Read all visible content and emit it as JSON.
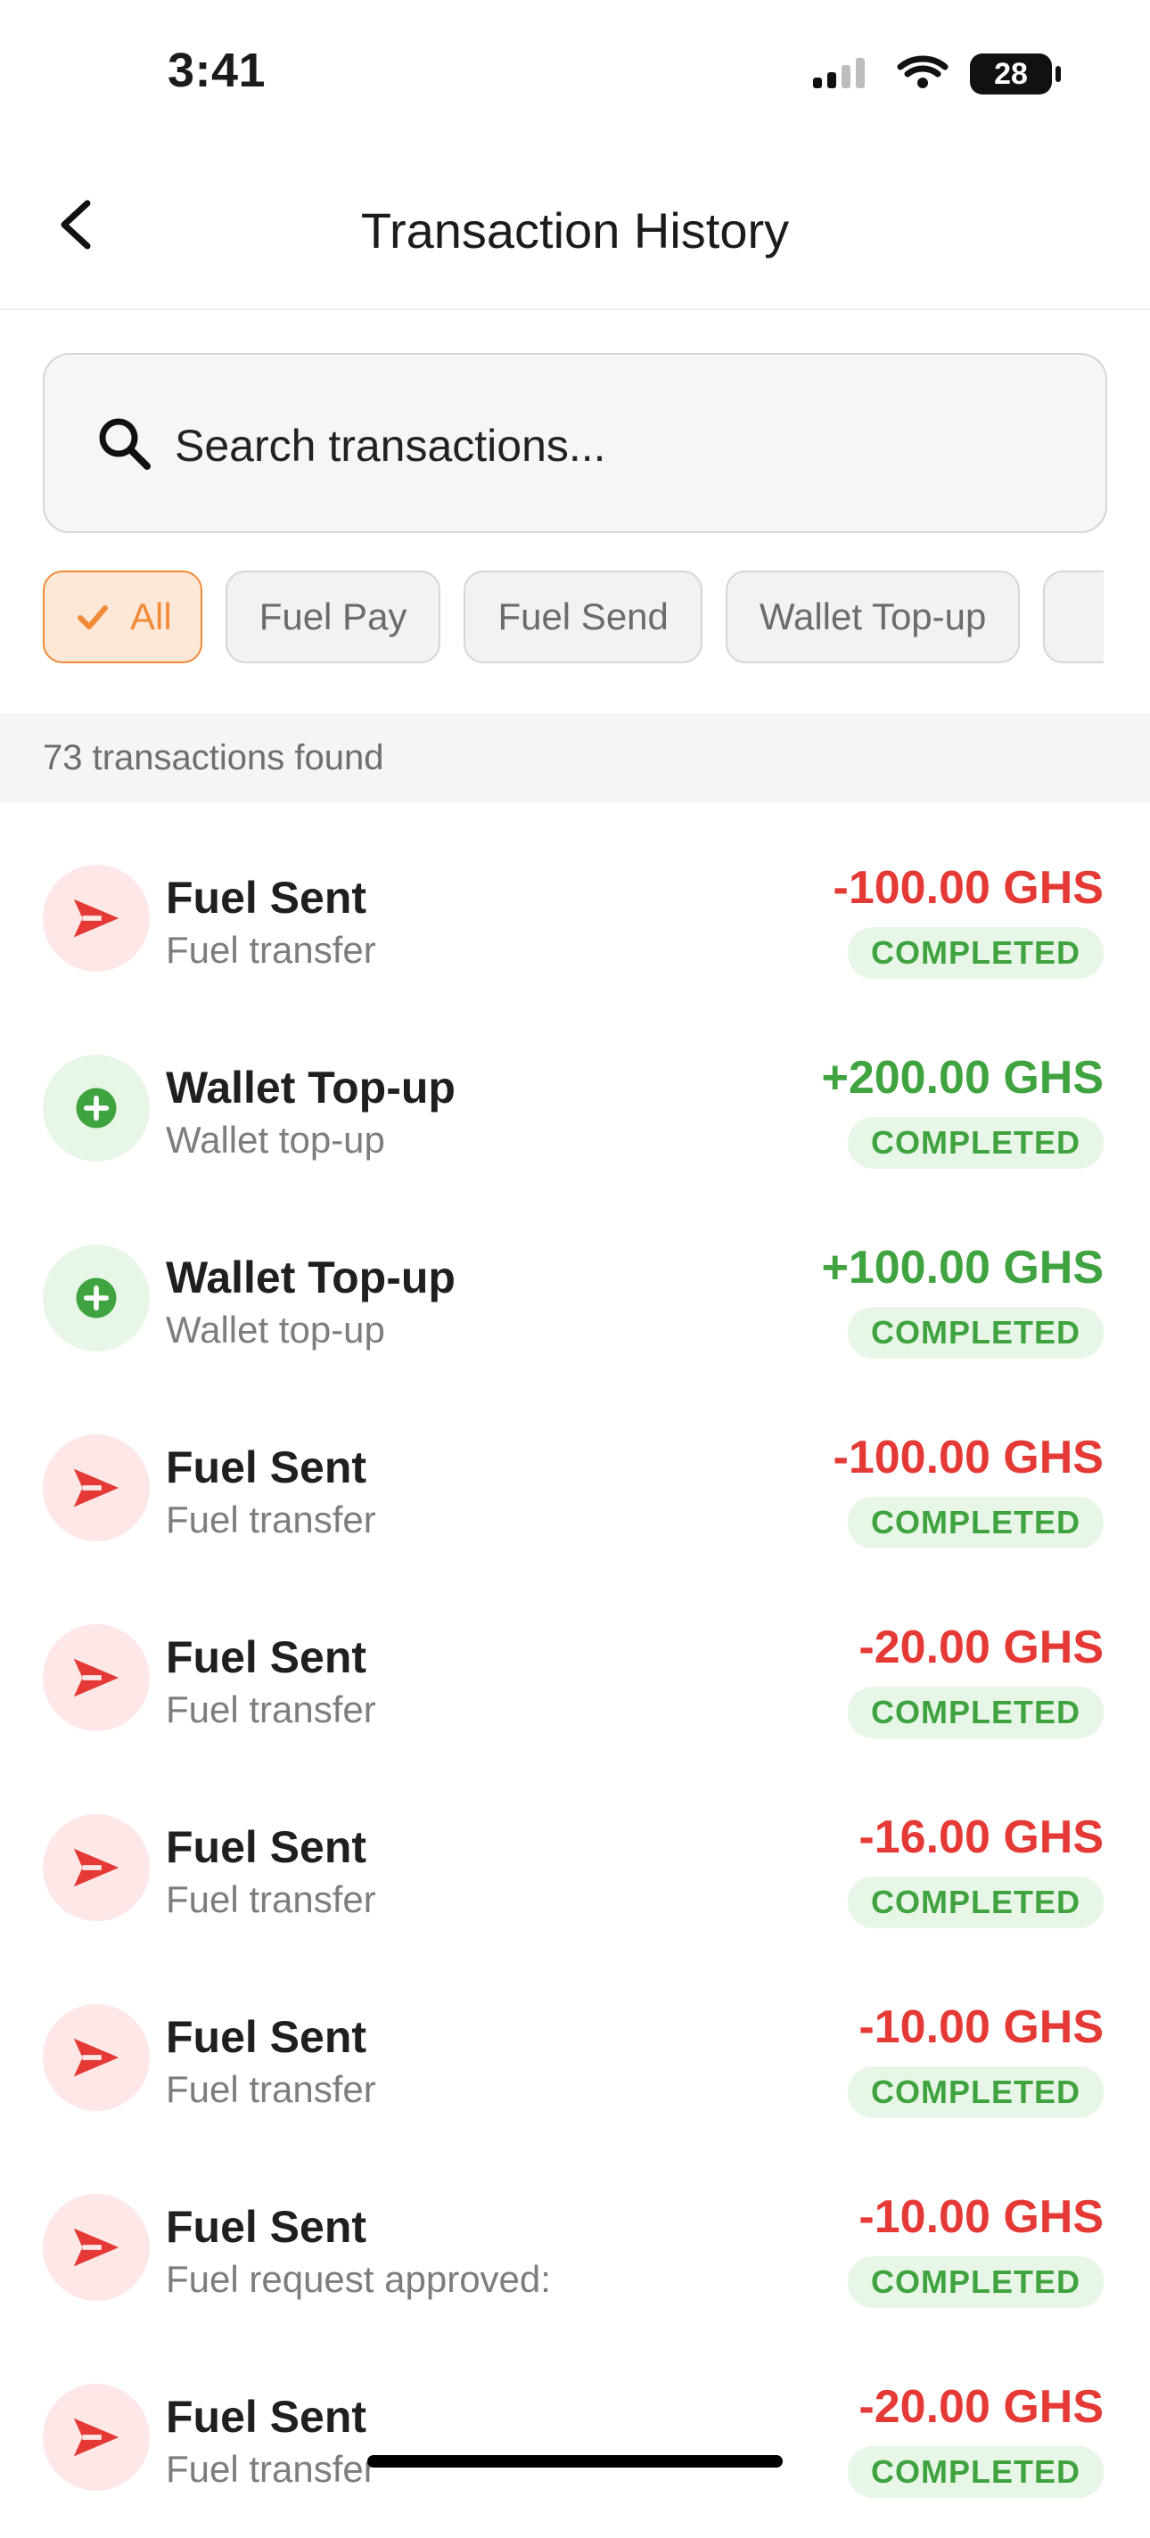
{
  "status_bar": {
    "time": "3:41",
    "battery": "28"
  },
  "header": {
    "title": "Transaction History"
  },
  "search": {
    "placeholder": "Search transactions..."
  },
  "filters": [
    {
      "label": "All"
    },
    {
      "label": "Fuel Pay"
    },
    {
      "label": "Fuel Send"
    },
    {
      "label": "Wallet Top-up"
    },
    {
      "label": ""
    }
  ],
  "results": {
    "text": "73 transactions found"
  },
  "transactions": [
    {
      "title": "Fuel Sent",
      "subtitle": "Fuel transfer",
      "amount": "-100.00 GHS",
      "status": "COMPLETED"
    },
    {
      "title": "Wallet Top-up",
      "subtitle": "Wallet top-up",
      "amount": "+200.00 GHS",
      "status": "COMPLETED"
    },
    {
      "title": "Wallet Top-up",
      "subtitle": "Wallet top-up",
      "amount": "+100.00 GHS",
      "status": "COMPLETED"
    },
    {
      "title": "Fuel Sent",
      "subtitle": "Fuel transfer",
      "amount": "-100.00 GHS",
      "status": "COMPLETED"
    },
    {
      "title": "Fuel Sent",
      "subtitle": "Fuel transfer",
      "amount": "-20.00 GHS",
      "status": "COMPLETED"
    },
    {
      "title": "Fuel Sent",
      "subtitle": "Fuel transfer",
      "amount": "-16.00 GHS",
      "status": "COMPLETED"
    },
    {
      "title": "Fuel Sent",
      "subtitle": "Fuel transfer",
      "amount": "-10.00 GHS",
      "status": "COMPLETED"
    },
    {
      "title": "Fuel Sent",
      "subtitle": "Fuel request approved:",
      "amount": "-10.00 GHS",
      "status": "COMPLETED"
    },
    {
      "title": "Fuel Sent",
      "subtitle": "Fuel transfer",
      "amount": "-20.00 GHS",
      "status": "COMPLETED"
    }
  ],
  "colors": {
    "accent": "#f08a37",
    "positive": "#3fa33f",
    "negative": "#e53935"
  },
  "icons": {
    "back": "chevron-left-icon",
    "search": "search-icon",
    "check": "check-icon",
    "send": "send-icon",
    "plus": "plus-circle-icon"
  }
}
